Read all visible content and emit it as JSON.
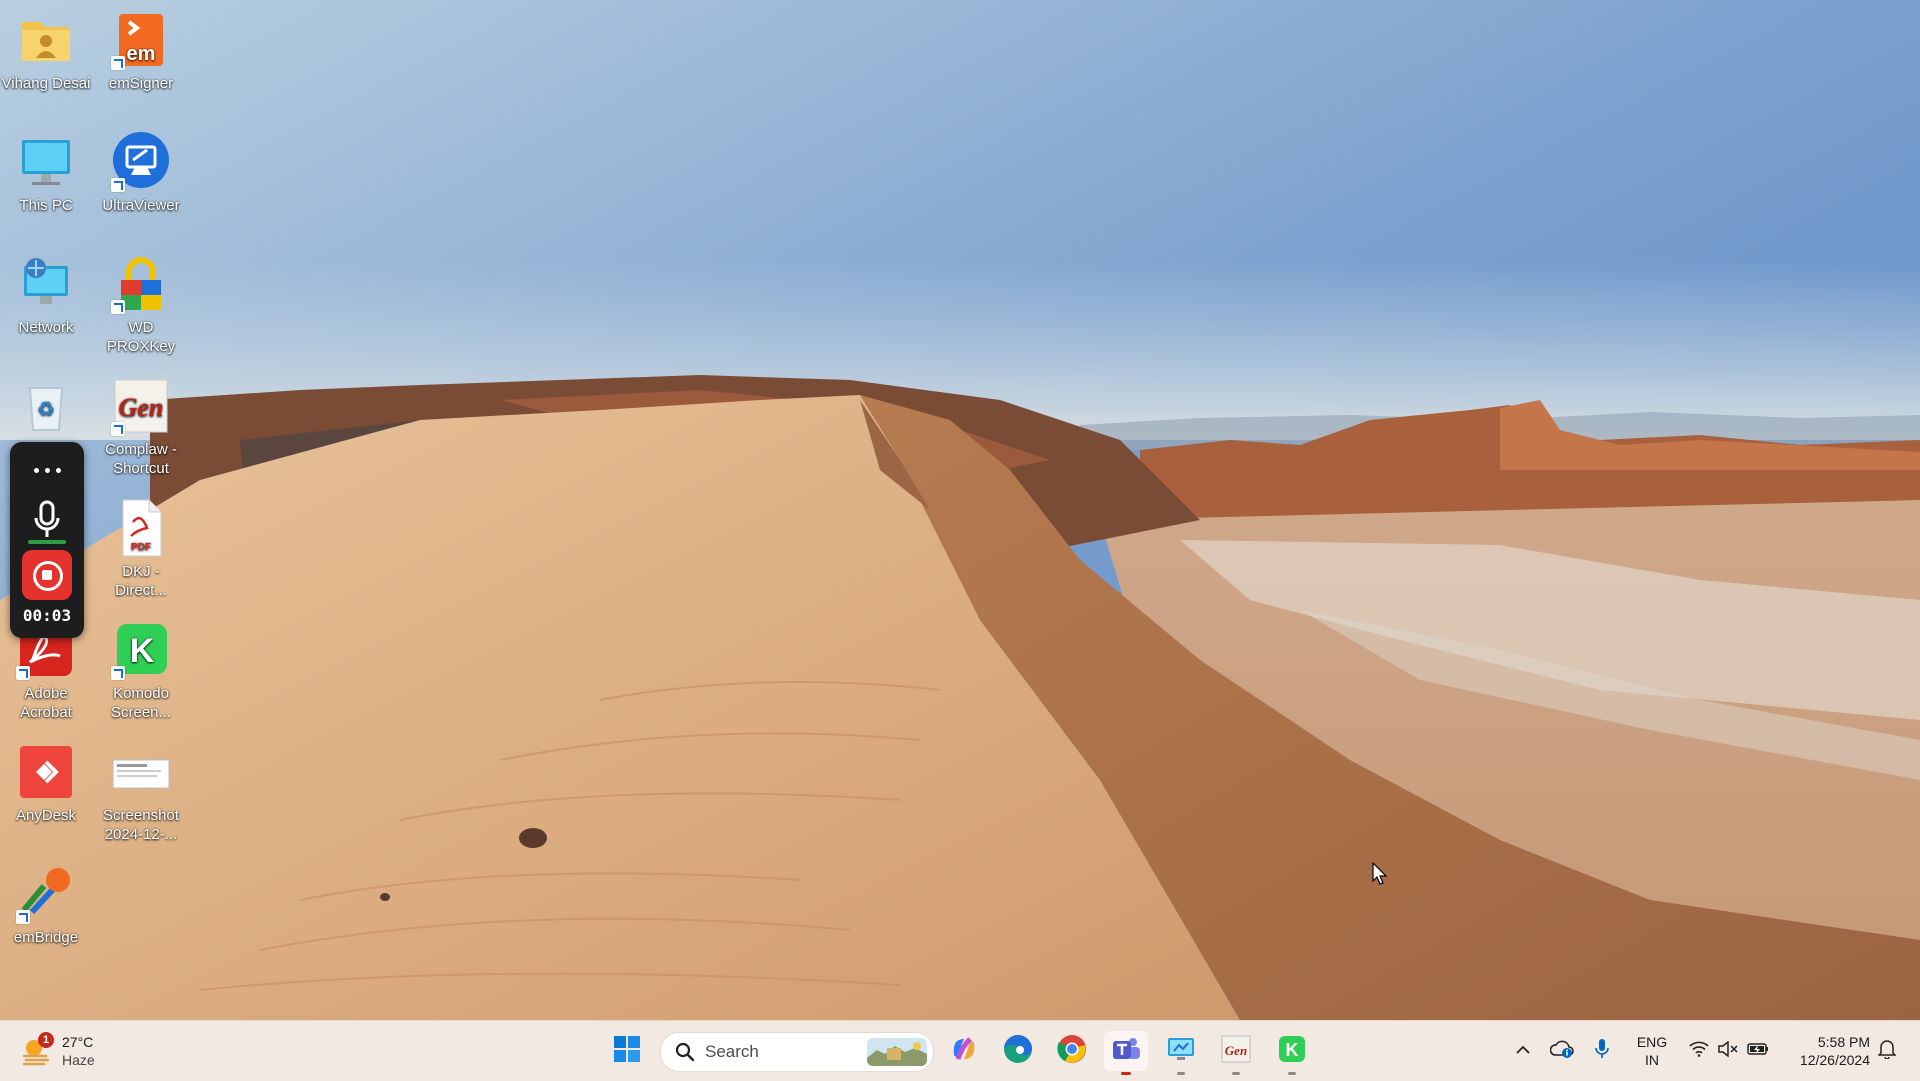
{
  "desktop": {
    "icons": [
      {
        "label": "Vihang Desai",
        "icon": "user-folder-icon"
      },
      {
        "label": "emSigner",
        "icon": "emsigner-icon"
      },
      {
        "label": "This PC",
        "icon": "monitor-icon"
      },
      {
        "label": "UltraViewer",
        "icon": "ultraviewer-icon"
      },
      {
        "label": "Network",
        "icon": "network-icon"
      },
      {
        "label": "WD PROXKey",
        "icon": "proxkey-lock-icon"
      },
      {
        "label": "",
        "icon": "recycle-bin-icon"
      },
      {
        "label": "Complaw - Shortcut",
        "icon": "complaw-icon"
      },
      {
        "label": "DKJ - Direct...",
        "icon": "pdf-file-icon"
      },
      {
        "label": "Adobe Acrobat",
        "icon": "acrobat-icon"
      },
      {
        "label": "Komodo Screen...",
        "icon": "komodo-icon"
      },
      {
        "label": "AnyDesk",
        "icon": "anydesk-icon"
      },
      {
        "label": "Screenshot 2024-12-...",
        "icon": "screenshot-file-icon"
      },
      {
        "label": "emBridge",
        "icon": "embridge-icon"
      }
    ]
  },
  "recorder": {
    "timer": "00:03",
    "more_icon": "more-dots-icon",
    "mic_icon": "microphone-icon",
    "stop_icon": "stop-record-icon"
  },
  "taskbar": {
    "weather": {
      "temp": "27°C",
      "condition": "Haze",
      "badge": "1"
    },
    "search_placeholder": "Search",
    "apps": [
      {
        "name": "start",
        "icon": "windows-start-icon"
      },
      {
        "name": "copilot",
        "icon": "copilot-icon"
      },
      {
        "name": "edge",
        "icon": "edge-icon"
      },
      {
        "name": "chrome",
        "icon": "chrome-icon"
      },
      {
        "name": "teams",
        "icon": "teams-icon"
      },
      {
        "name": "remote-desktop",
        "icon": "remote-desktop-icon"
      },
      {
        "name": "complaw",
        "icon": "complaw-icon"
      },
      {
        "name": "komodo",
        "icon": "komodo-icon"
      }
    ],
    "tray": {
      "language_line1": "ENG",
      "language_line2": "IN",
      "time": "5:58 PM",
      "date": "12/26/2024"
    }
  },
  "colors": {
    "taskbar_bg": "#f3e9e3",
    "accent": "#0067c0",
    "record_red": "#e5322d"
  }
}
